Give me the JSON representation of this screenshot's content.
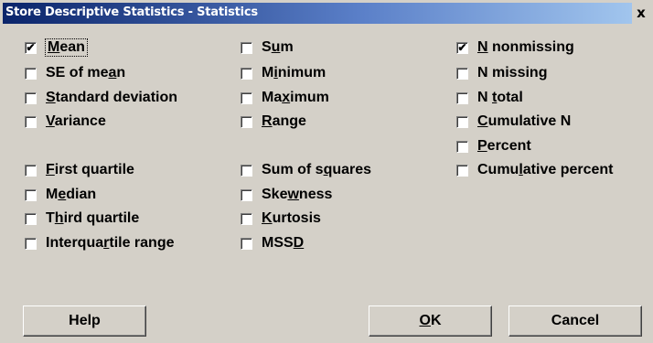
{
  "window": {
    "title": "Store Descriptive Statistics - Statistics",
    "close_label": "x"
  },
  "columns": [
    [
      {
        "id": "mean",
        "label": "Mean",
        "checked": true,
        "accel": 0
      },
      {
        "id": "se-of-mean",
        "label": "SE of mean",
        "checked": false,
        "accel": 8
      },
      {
        "id": "standard-deviation",
        "label": "Standard deviation",
        "checked": false,
        "accel": 0
      },
      {
        "id": "variance",
        "label": "Variance",
        "checked": false,
        "accel": 0
      },
      {
        "id": "first-quartile",
        "label": "First quartile",
        "checked": false,
        "accel": 0
      },
      {
        "id": "median",
        "label": "Median",
        "checked": false,
        "accel": 1
      },
      {
        "id": "third-quartile",
        "label": "Third quartile",
        "checked": false,
        "accel": 1
      },
      {
        "id": "interquartile-range",
        "label": "Interquartile range",
        "checked": false,
        "accel": 8
      }
    ],
    [
      {
        "id": "sum",
        "label": "Sum",
        "checked": false,
        "accel": 1
      },
      {
        "id": "minimum",
        "label": "Minimum",
        "checked": false,
        "accel": 1
      },
      {
        "id": "maximum",
        "label": "Maximum",
        "checked": false,
        "accel": 2
      },
      {
        "id": "range",
        "label": "Range",
        "checked": false,
        "accel": 0
      },
      {
        "id": "sum-of-squares",
        "label": "Sum of squares",
        "checked": false,
        "accel": 8
      },
      {
        "id": "skewness",
        "label": "Skewness",
        "checked": false,
        "accel": 3
      },
      {
        "id": "kurtosis",
        "label": "Kurtosis",
        "checked": false,
        "accel": 0
      },
      {
        "id": "mssd",
        "label": "MSSD",
        "checked": false,
        "accel": 3
      }
    ],
    [
      {
        "id": "n-nonmissing",
        "label": "N nonmissing",
        "checked": true,
        "accel": 0
      },
      {
        "id": "n-missing",
        "label": "N missing",
        "checked": false,
        "accel": 8
      },
      {
        "id": "n-total",
        "label": "N total",
        "checked": false,
        "accel": 2
      },
      {
        "id": "cumulative-n",
        "label": "Cumulative N",
        "checked": false,
        "accel": 0
      },
      {
        "id": "percent",
        "label": "Percent",
        "checked": false,
        "accel": 0
      },
      {
        "id": "cumulative-percent",
        "label": "Cumulative percent",
        "checked": false,
        "accel": 4
      }
    ]
  ],
  "buttons": {
    "help": "Help",
    "ok": "OK",
    "ok_accel": 0,
    "cancel": "Cancel"
  }
}
